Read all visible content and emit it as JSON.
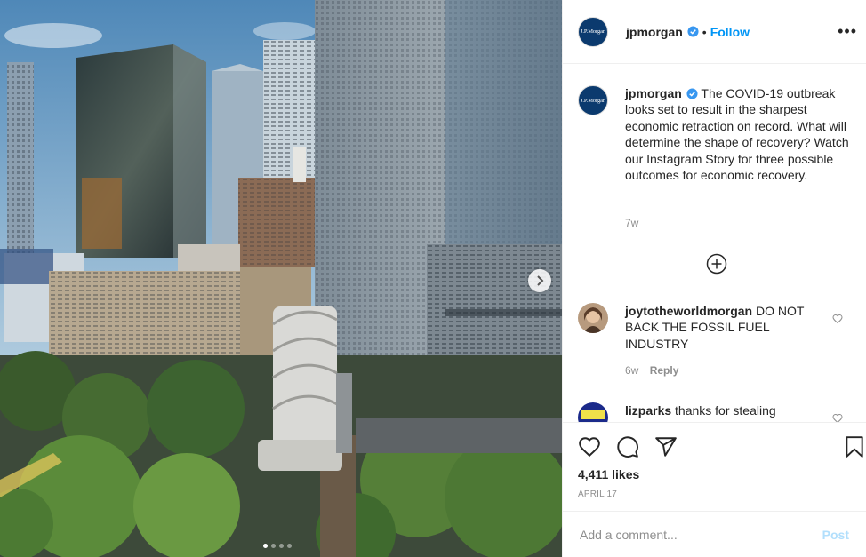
{
  "post": {
    "username": "jpmorgan",
    "follow_label": "Follow",
    "separator": "•",
    "more_label": "•••",
    "avatar_text": "J.P.Morgan",
    "caption": "The COVID-19 outbreak looks set to result in the sharpest economic retraction on record. What will determine the shape of recovery? Watch our Instagram Story for three possible outcomes for economic recovery.",
    "caption_time": "7w",
    "likes": "4,411 likes",
    "date": "APRIL 17",
    "carousel_count": 4,
    "carousel_active": 1
  },
  "comments": [
    {
      "username": "joytotheworldmorgan",
      "text": "DO NOT BACK THE FOSSIL FUEL INDUSTRY",
      "time": "6w",
      "reply_label": "Reply"
    },
    {
      "username": "lizparks",
      "text": "thanks for stealing"
    }
  ],
  "composer": {
    "placeholder": "Add a comment...",
    "post_label": "Post"
  },
  "colors": {
    "accent": "#0095f6",
    "verified": "#3897f0",
    "muted": "#8e8e8e",
    "post_disabled": "#b2dffc"
  },
  "icons": [
    "verified-badge-icon",
    "more-options-icon",
    "load-more-comments-icon",
    "heart-icon",
    "comment-icon",
    "share-icon",
    "bookmark-icon",
    "next-arrow-icon"
  ]
}
